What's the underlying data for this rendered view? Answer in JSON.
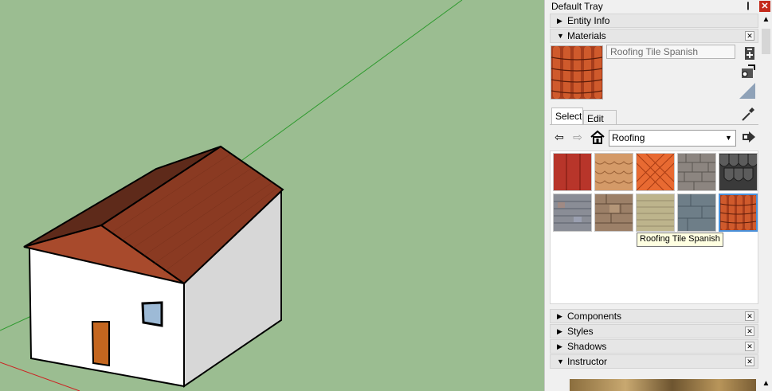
{
  "tray": {
    "title": "Default Tray",
    "pin_glyph": "❙",
    "close_glyph": "✕"
  },
  "panels": {
    "entity_info": {
      "label": "Entity Info",
      "arrow": "▶"
    },
    "materials": {
      "label": "Materials",
      "arrow": "▼",
      "close": "✕"
    },
    "components": {
      "label": "Components",
      "arrow": "▶",
      "close": "✕"
    },
    "styles": {
      "label": "Styles",
      "arrow": "▶",
      "close": "✕"
    },
    "shadows": {
      "label": "Shadows",
      "arrow": "▶",
      "close": "✕"
    },
    "instructor": {
      "label": "Instructor",
      "arrow": "▼",
      "close": "✕"
    }
  },
  "materials": {
    "name_value": "Roofing Tile Spanish",
    "tabs": {
      "select": "Select",
      "edit": "Edit"
    },
    "collection": "Roofing",
    "dropdown_glyph": "▼",
    "nav": {
      "back": "⇦",
      "forward": "⇨"
    },
    "tooltip": "Roofing Tile Spanish",
    "swatches": [
      {
        "icon": "red-metal-roof-swatch"
      },
      {
        "icon": "tan-fish-scale-shingle-swatch"
      },
      {
        "icon": "orange-diamond-tile-swatch"
      },
      {
        "icon": "gray-slate-shingle-swatch"
      },
      {
        "icon": "dark-scalloped-shingle-swatch"
      },
      {
        "icon": "blue-gray-shingle-swatch"
      },
      {
        "icon": "brown-wood-shake-swatch"
      },
      {
        "icon": "beige-cedar-shingle-swatch"
      },
      {
        "icon": "blue-slate-swatch"
      },
      {
        "icon": "spanish-tile-swatch"
      }
    ],
    "selected_index": 9
  },
  "scroll": {
    "up": "▲",
    "down": "▲"
  },
  "colors": {
    "viewport_bg": "#9bbd91",
    "roof": "#8a3a22",
    "wall": "#ffffff",
    "door": "#c4661f",
    "window": "#9dbad6",
    "selection": "#4a90d9"
  }
}
